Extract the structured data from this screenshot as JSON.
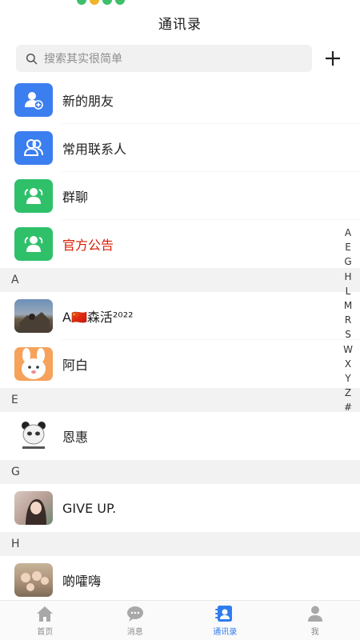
{
  "header": {
    "title": "通讯录"
  },
  "search": {
    "placeholder": "搜索其实很简单"
  },
  "quick_items": [
    {
      "label": "新的朋友",
      "icon": "add-friend-icon",
      "color": "#3b7ef0"
    },
    {
      "label": "常用联系人",
      "icon": "contacts-icon",
      "color": "#3b7ef0"
    },
    {
      "label": "群聊",
      "icon": "group-icon",
      "color": "#2fc16a"
    },
    {
      "label": "官方公告",
      "icon": "group-icon",
      "color": "#2fc16a",
      "label_color": "#d81e06"
    }
  ],
  "sections": [
    {
      "letter": "A",
      "contacts": [
        {
          "name": "A🇨🇳森活²⁰²²"
        },
        {
          "name": "阿白"
        }
      ]
    },
    {
      "letter": "E",
      "contacts": [
        {
          "name": "恩惠"
        }
      ]
    },
    {
      "letter": "G",
      "contacts": [
        {
          "name": "GIVE UP."
        }
      ]
    },
    {
      "letter": "H",
      "contacts": [
        {
          "name": "啲嚯嗨"
        }
      ]
    }
  ],
  "index_letters": [
    "A",
    "E",
    "G",
    "H",
    "L",
    "M",
    "R",
    "S",
    "W",
    "X",
    "Y",
    "Z",
    "#"
  ],
  "tabs": [
    {
      "label": "首页",
      "icon": "home-icon",
      "active": false
    },
    {
      "label": "消息",
      "icon": "message-icon",
      "active": false
    },
    {
      "label": "通讯录",
      "icon": "contacts-tab-icon",
      "active": true
    },
    {
      "label": "我",
      "icon": "profile-icon",
      "active": false
    }
  ],
  "colors": {
    "accent": "#2f7cf0",
    "blue": "#3b7ef0",
    "green": "#2fc16a",
    "announcement_red": "#d81e06"
  }
}
